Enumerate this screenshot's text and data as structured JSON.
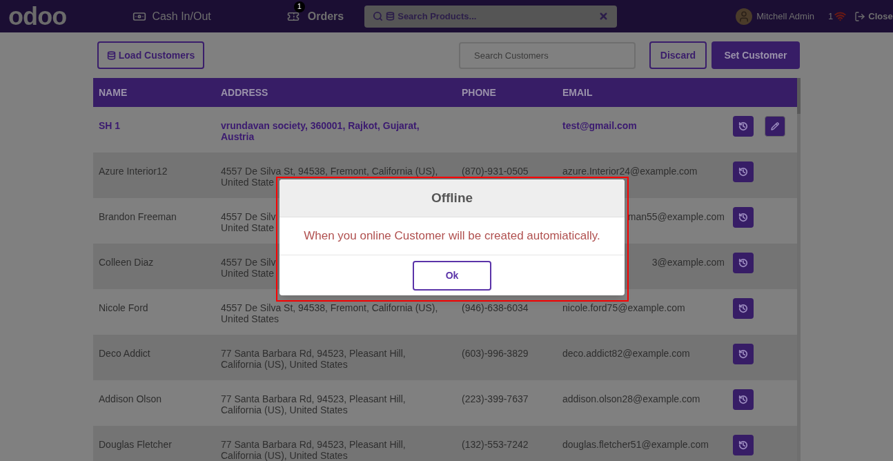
{
  "navbar": {
    "logo": "odoo",
    "cash_button": "Cash In/Out",
    "orders_button": {
      "label": "Orders",
      "badge": "1"
    },
    "product_search": {
      "placeholder": "Search Products..."
    },
    "user": "Mitchell Admin",
    "sync_count": "1",
    "close_button": "Close"
  },
  "toolbar": {
    "load_button": "Load Customers",
    "customer_search": {
      "placeholder": "Search Customers"
    },
    "discard_button": "Discard",
    "set_button": "Set Customer"
  },
  "table": {
    "columns": [
      "NAME",
      "ADDRESS",
      "PHONE",
      "EMAIL"
    ],
    "rows": [
      {
        "name": "SH 1",
        "address_lines": [
          "vrundavan society, 360001, Rajkot, Gujarat,",
          "Austria"
        ],
        "phone": "",
        "email": "test@gmail.com",
        "selected": true
      },
      {
        "name": "Azure Interior12",
        "address_lines": [
          "4557 De Silva St, 94538, Fremont, California (US),",
          "United State"
        ],
        "phone": "(870)-931-0505",
        "email": "azure.Interior24@example.com",
        "selected": false
      },
      {
        "name": "Brandon Freeman",
        "address_lines": [
          "4557 De Silv",
          "United State"
        ],
        "phone": "",
        "email": "man55@example.com",
        "email_cut": true,
        "selected": false
      },
      {
        "name": "Colleen Diaz",
        "address_lines": [
          "4557 De Silv",
          "United State"
        ],
        "phone": "",
        "email": "3@example.com",
        "email_cut": true,
        "selected": false
      },
      {
        "name": "Nicole Ford",
        "address_lines": [
          "4557 De Silva St, 94538, Fremont, California (US),",
          "United States"
        ],
        "phone": "(946)-638-6034",
        "email": "nicole.ford75@example.com",
        "selected": false
      },
      {
        "name": "Deco Addict",
        "address_lines": [
          "77 Santa Barbara Rd, 94523, Pleasant Hill,",
          "California (US), United States"
        ],
        "phone": "(603)-996-3829",
        "email": "deco.addict82@example.com",
        "selected": false
      },
      {
        "name": "Addison Olson",
        "address_lines": [
          "77 Santa Barbara Rd, 94523, Pleasant Hill,",
          "California (US), United States"
        ],
        "phone": "(223)-399-7637",
        "email": "addison.olson28@example.com",
        "selected": false
      },
      {
        "name": "Douglas Fletcher",
        "address_lines": [
          "77 Santa Barbara Rd, 94523, Pleasant Hill,",
          "California (US), United States"
        ],
        "phone": "(132)-553-7242",
        "email": "douglas.fletcher51@example.com",
        "selected": false
      }
    ]
  },
  "dialog": {
    "title": "Offline",
    "message": "When you online Customer will be created automiatically.",
    "ok_button": "Ok"
  }
}
